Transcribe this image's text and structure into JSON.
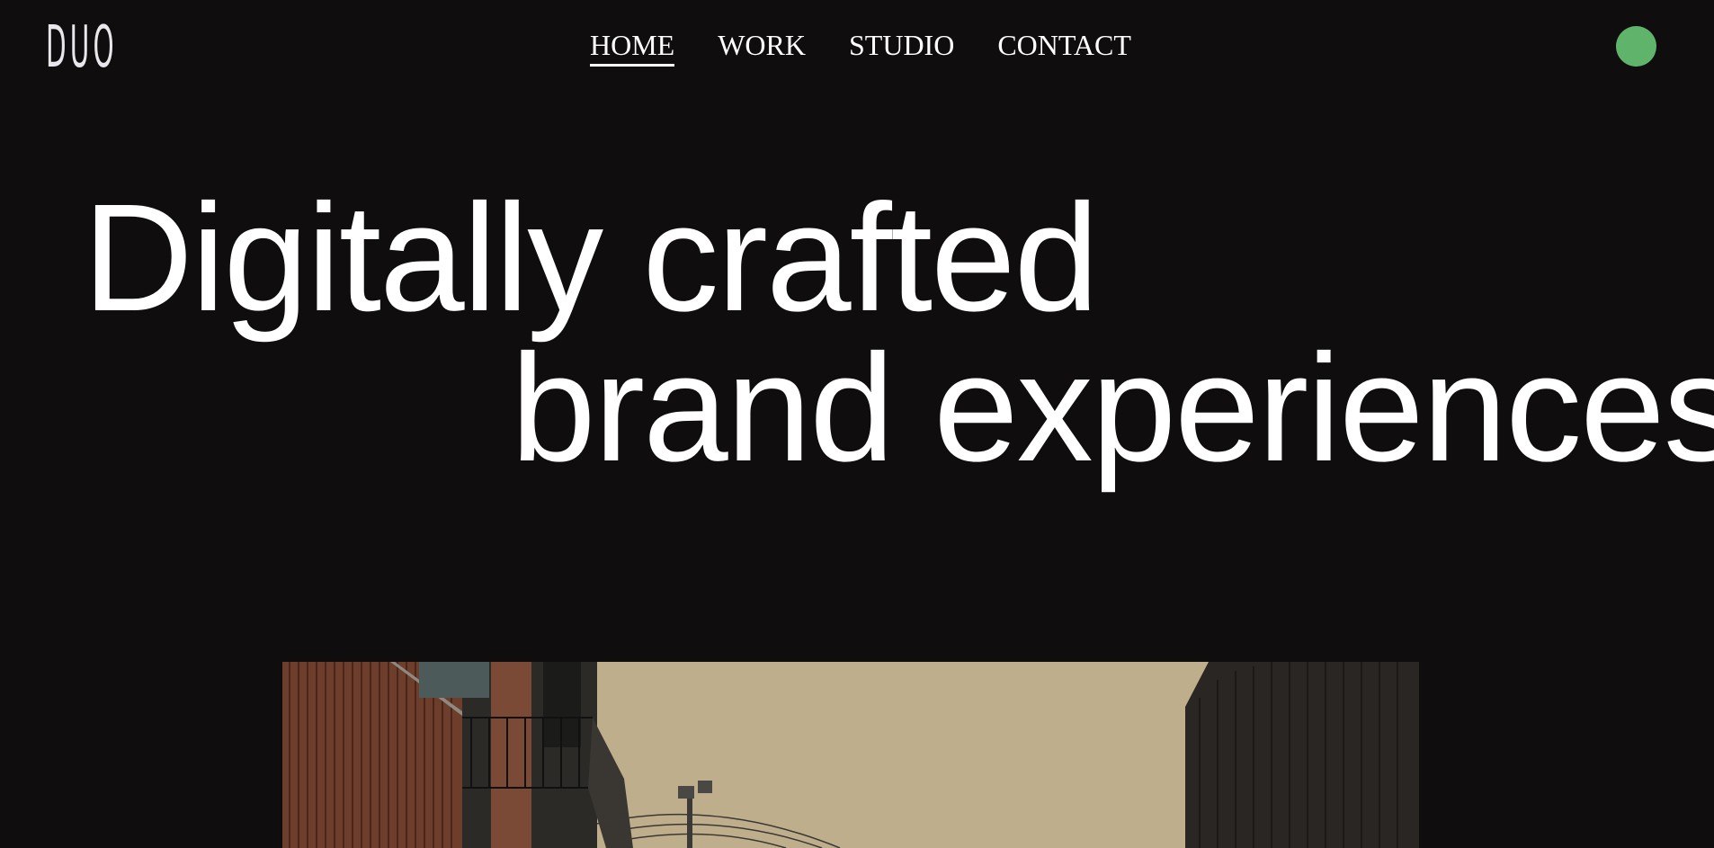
{
  "brand": {
    "logo_text": "DUO"
  },
  "nav": {
    "items": [
      {
        "label": "HOME",
        "active": true
      },
      {
        "label": "WORK",
        "active": false
      },
      {
        "label": "STUDIO",
        "active": false
      },
      {
        "label": "CONTACT",
        "active": false
      }
    ]
  },
  "status": {
    "color": "#5fb36b"
  },
  "hero": {
    "line1": "Digitally crafted",
    "line2": "brand experiences"
  },
  "media": {
    "icon": "video-frame-street-scene"
  },
  "colors": {
    "background": "#0f0d0e",
    "text": "#ffffff",
    "accent": "#5fb36b"
  }
}
